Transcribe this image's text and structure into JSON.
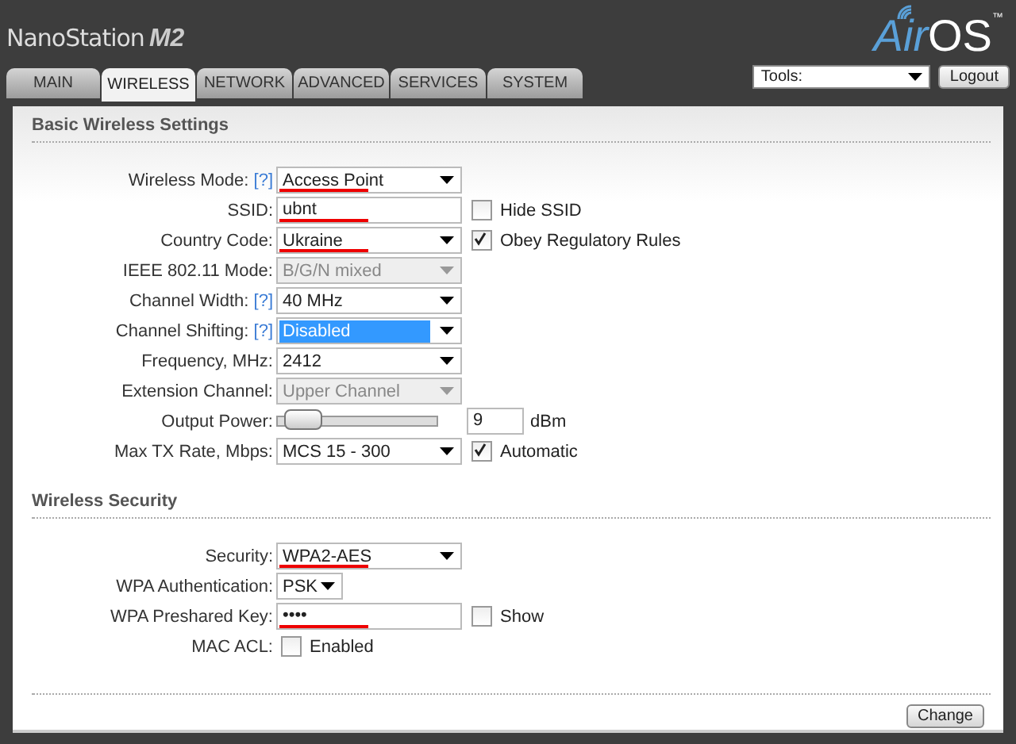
{
  "header": {
    "product": "NanoStation",
    "model": "M2",
    "logo_main": "Air",
    "logo_os": "OS",
    "logo_tm": "™"
  },
  "tabs": [
    {
      "label": "MAIN",
      "selected": false
    },
    {
      "label": "WIRELESS",
      "selected": true
    },
    {
      "label": "NETWORK",
      "selected": false
    },
    {
      "label": "ADVANCED",
      "selected": false
    },
    {
      "label": "SERVICES",
      "selected": false
    },
    {
      "label": "SYSTEM",
      "selected": false
    }
  ],
  "tools": {
    "value": "Tools:"
  },
  "logout_button": "Logout",
  "sections": [
    {
      "title": "Basic Wireless Settings",
      "rows": [
        {
          "label": "Wireless Mode:",
          "help": "[?]",
          "kind": "select",
          "value": "Access Point",
          "underlined": true,
          "disabled": false,
          "focused": false
        },
        {
          "label": "SSID:",
          "kind": "text",
          "value": "ubnt",
          "underlined": true,
          "check": {
            "label": "Hide SSID",
            "checked": false
          }
        },
        {
          "label": "Country Code:",
          "kind": "select",
          "value": "Ukraine",
          "underlined": true,
          "disabled": false,
          "focused": false,
          "check": {
            "label": "Obey Regulatory Rules",
            "checked": true
          }
        },
        {
          "label": "IEEE 802.11 Mode:",
          "kind": "select",
          "value": "B/G/N mixed",
          "underlined": false,
          "disabled": true,
          "focused": false
        },
        {
          "label": "Channel Width:",
          "help": "[?]",
          "kind": "select",
          "value": "40 MHz",
          "underlined": false,
          "disabled": false,
          "focused": false
        },
        {
          "label": "Channel Shifting:",
          "help": "[?]",
          "kind": "select",
          "value": "Disabled",
          "underlined": false,
          "disabled": false,
          "focused": true
        },
        {
          "label": "Frequency, MHz:",
          "kind": "select",
          "value": "2412",
          "underlined": false,
          "disabled": false,
          "focused": false
        },
        {
          "label": "Extension Channel:",
          "kind": "select",
          "value": "Upper Channel",
          "underlined": false,
          "disabled": true,
          "focused": false
        },
        {
          "label": "Output Power:",
          "kind": "slider",
          "level": 0.05,
          "value": "9",
          "unit": "dBm"
        },
        {
          "label": "Max TX Rate, Mbps:",
          "kind": "select",
          "value": "MCS 15 - 300",
          "underlined": false,
          "disabled": false,
          "focused": false,
          "check": {
            "label": "Automatic",
            "checked": true
          }
        }
      ]
    },
    {
      "title": "Wireless Security",
      "rows": [
        {
          "label": "Security:",
          "kind": "select",
          "value": "WPA2-AES",
          "underlined": true,
          "disabled": false,
          "focused": false
        },
        {
          "label": "WPA Authentication:",
          "kind": "smallselect",
          "value": "PSK",
          "underlined": false,
          "disabled": false,
          "focused": false
        },
        {
          "label": "WPA Preshared Key:",
          "kind": "password",
          "value": "••••",
          "underlined": true,
          "check": {
            "label": "Show",
            "checked": false
          }
        },
        {
          "label": "MAC ACL:",
          "kind": "checkbox",
          "check": {
            "label": "Enabled",
            "checked": false
          }
        }
      ]
    }
  ],
  "change_button": "Change"
}
